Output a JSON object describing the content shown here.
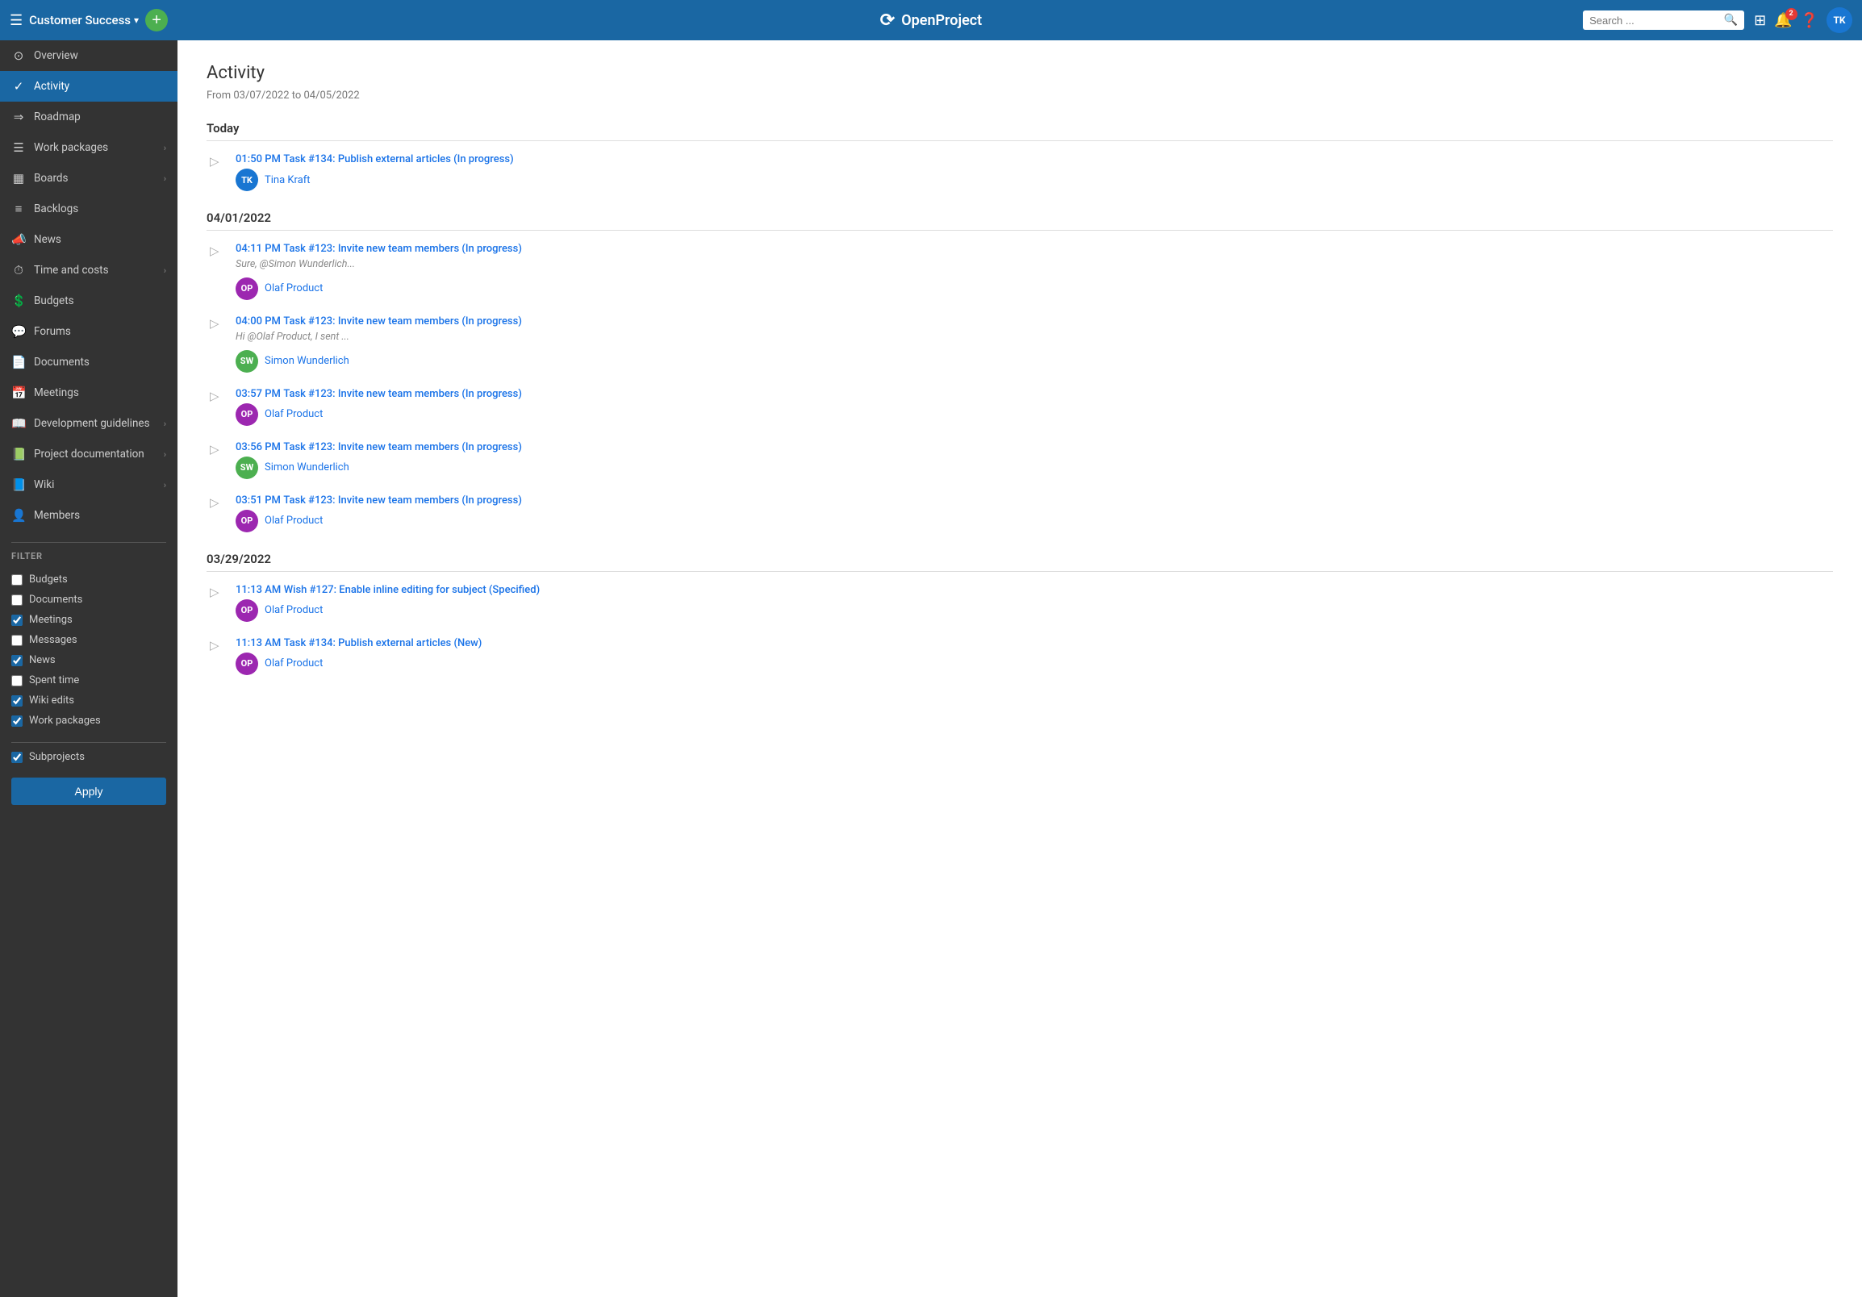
{
  "topNav": {
    "projectName": "Customer Success",
    "addBtnLabel": "+",
    "logoText": "OpenProject",
    "search": {
      "placeholder": "Search ..."
    },
    "notificationCount": "2",
    "avatarInitials": "TK"
  },
  "sidebar": {
    "items": [
      {
        "id": "overview",
        "label": "Overview",
        "icon": "⊙",
        "hasArrow": false
      },
      {
        "id": "activity",
        "label": "Activity",
        "icon": "✓",
        "hasArrow": false,
        "active": true
      },
      {
        "id": "roadmap",
        "label": "Roadmap",
        "icon": "▦",
        "hasArrow": false
      },
      {
        "id": "work-packages",
        "label": "Work packages",
        "icon": "▣",
        "hasArrow": true
      },
      {
        "id": "boards",
        "label": "Boards",
        "icon": "▤",
        "hasArrow": true
      },
      {
        "id": "backlogs",
        "label": "Backlogs",
        "icon": "🔔",
        "hasArrow": false
      },
      {
        "id": "news",
        "label": "News",
        "icon": "📢",
        "hasArrow": false
      },
      {
        "id": "time-costs",
        "label": "Time and costs",
        "icon": "⏱",
        "hasArrow": true
      },
      {
        "id": "budgets",
        "label": "Budgets",
        "icon": "💰",
        "hasArrow": false
      },
      {
        "id": "forums",
        "label": "Forums",
        "icon": "💬",
        "hasArrow": false
      },
      {
        "id": "documents",
        "label": "Documents",
        "icon": "📄",
        "hasArrow": false
      },
      {
        "id": "meetings",
        "label": "Meetings",
        "icon": "📅",
        "hasArrow": false
      },
      {
        "id": "dev-guidelines",
        "label": "Development guidelines",
        "icon": "📖",
        "hasArrow": true
      },
      {
        "id": "project-doc",
        "label": "Project documentation",
        "icon": "📗",
        "hasArrow": true
      },
      {
        "id": "wiki",
        "label": "Wiki",
        "icon": "📘",
        "hasArrow": true
      },
      {
        "id": "members",
        "label": "Members",
        "icon": "👥",
        "hasArrow": false
      }
    ],
    "filterTitle": "FILTER",
    "filterItems": [
      {
        "id": "budgets",
        "label": "Budgets",
        "checked": false
      },
      {
        "id": "documents",
        "label": "Documents",
        "checked": false
      },
      {
        "id": "meetings",
        "label": "Meetings",
        "checked": true
      },
      {
        "id": "messages",
        "label": "Messages",
        "checked": false
      },
      {
        "id": "news",
        "label": "News",
        "checked": true
      },
      {
        "id": "spent-time",
        "label": "Spent time",
        "checked": false
      },
      {
        "id": "wiki-edits",
        "label": "Wiki edits",
        "checked": true
      },
      {
        "id": "work-packages",
        "label": "Work packages",
        "checked": true
      }
    ],
    "subprojectsLabel": "Subprojects",
    "subprojectsChecked": true,
    "applyLabel": "Apply"
  },
  "content": {
    "title": "Activity",
    "dateRange": "From 03/07/2022 to 04/05/2022",
    "groups": [
      {
        "label": "Today",
        "items": [
          {
            "time": "01:50 PM",
            "link": "Task #134: Publish external articles (In progress)",
            "excerpt": "",
            "user": {
              "initials": "TK",
              "name": "Tina Kraft",
              "color": "#1976d2"
            }
          }
        ]
      },
      {
        "label": "04/01/2022",
        "items": [
          {
            "time": "04:11 PM",
            "link": "Task #123: Invite new team members (In progress)",
            "excerpt": "Sure, <mention class=\"mention\" data-id=\"5\" data-type=\"user\" data-text=\"@Simon Wunderlich\">@Simon Wunderlich</mention>...",
            "user": {
              "initials": "OP",
              "name": "Olaf Product",
              "color": "#9c27b0"
            }
          },
          {
            "time": "04:00 PM",
            "link": "Task #123: Invite new team members (In progress)",
            "excerpt": "Hi <mention class=\"mention\" data-id=\"1\" data-type=\"user\" data-text=\"@Olaf Product\">@Olaf Product</mention>, I sent ...",
            "user": {
              "initials": "SW",
              "name": "Simon Wunderlich",
              "color": "#4caf50"
            }
          },
          {
            "time": "03:57 PM",
            "link": "Task #123: Invite new team members (In progress)",
            "excerpt": "",
            "user": {
              "initials": "OP",
              "name": "Olaf Product",
              "color": "#9c27b0"
            }
          },
          {
            "time": "03:56 PM",
            "link": "Task #123: Invite new team members (In progress)",
            "excerpt": "",
            "user": {
              "initials": "SW",
              "name": "Simon Wunderlich",
              "color": "#4caf50"
            }
          },
          {
            "time": "03:51 PM",
            "link": "Task #123: Invite new team members (In progress)",
            "excerpt": "",
            "user": {
              "initials": "OP",
              "name": "Olaf Product",
              "color": "#9c27b0"
            }
          }
        ]
      },
      {
        "label": "03/29/2022",
        "items": [
          {
            "time": "11:13 AM",
            "link": "Wish #127: Enable inline editing for subject (Specified)",
            "excerpt": "",
            "user": {
              "initials": "OP",
              "name": "Olaf Product",
              "color": "#9c27b0"
            }
          },
          {
            "time": "11:13 AM",
            "link": "Task #134: Publish external articles (New)",
            "excerpt": "",
            "user": {
              "initials": "OP",
              "name": "Olaf Product",
              "color": "#9c27b0"
            }
          }
        ]
      }
    ]
  }
}
